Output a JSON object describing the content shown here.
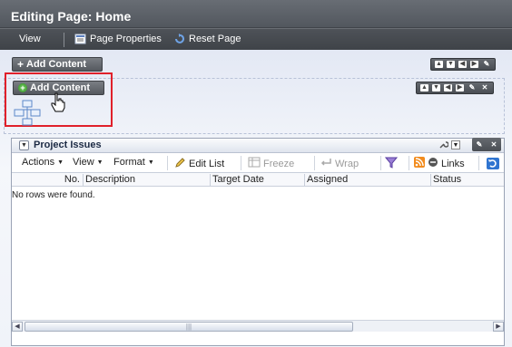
{
  "window": {
    "title": "Editing Page: Home"
  },
  "toolbar": {
    "view_label": "View",
    "page_properties_label": "Page Properties",
    "reset_page_label": "Reset Page"
  },
  "layout": {
    "add_content_top_label": "Add Content",
    "add_content_label": "Add Content",
    "region_controls": [
      "move-up",
      "move-down",
      "move-left",
      "move-right",
      "edit"
    ],
    "box_controls": [
      "move-up",
      "move-down",
      "move-left",
      "move-right",
      "edit",
      "close"
    ]
  },
  "panel": {
    "title": "Project Issues",
    "toolbar": {
      "actions": "Actions",
      "view": "View",
      "format": "Format",
      "edit_list": "Edit List",
      "freeze": "Freeze",
      "wrap": "Wrap",
      "links": "Links"
    },
    "columns": [
      "No.",
      "Description",
      "Target Date",
      "Assigned",
      "Status"
    ],
    "empty_message": "No rows were found."
  },
  "colors": {
    "title_bar": "#5e6369",
    "highlight": "#e0202a",
    "panel_border": "#9aa3b5"
  }
}
